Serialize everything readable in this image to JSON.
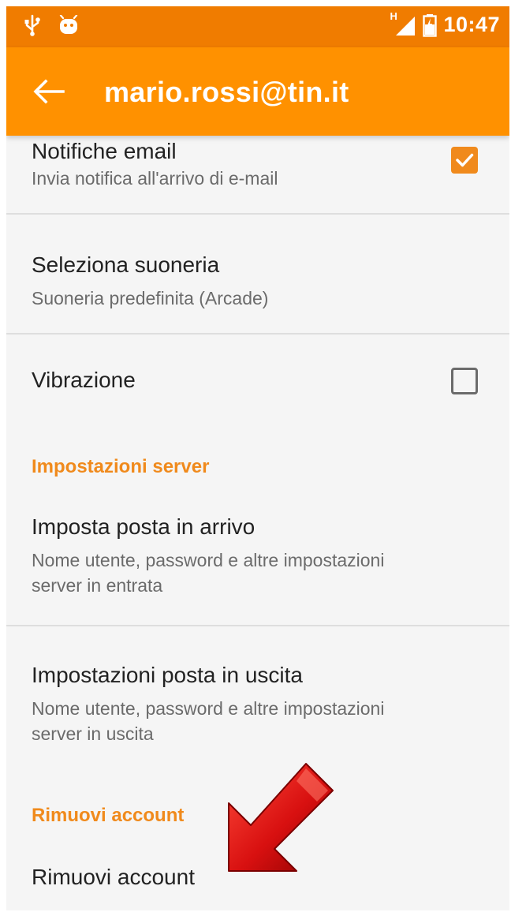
{
  "status_bar": {
    "icons": [
      "usb-icon",
      "android-icon",
      "signal-icon",
      "battery-icon"
    ],
    "network_indicator": "H",
    "time": "10:47"
  },
  "app_bar": {
    "title": "mario.rossi@tin.it",
    "back_icon": "arrow-left-icon"
  },
  "settings": {
    "email_notifications": {
      "title": "Notifiche email",
      "summary": "Invia notifica all'arrivo di e-mail",
      "checked": true
    },
    "ringtone": {
      "title": "Seleziona suoneria",
      "summary": "Suoneria predefinita (Arcade)"
    },
    "vibration": {
      "title": "Vibrazione",
      "checked": false
    },
    "server_category": "Impostazioni server",
    "incoming": {
      "title": "Imposta posta in arrivo",
      "summary_line1": "Nome utente, password e altre impostazioni",
      "summary_line2": "server in entrata"
    },
    "outgoing": {
      "title": "Impostazioni posta in uscita",
      "summary_line1": "Nome utente, password e altre impostazioni",
      "summary_line2": "server in uscita"
    },
    "remove_category": "Rimuovi account",
    "remove_account": {
      "title": "Rimuovi account"
    }
  },
  "colors": {
    "status_bar": "#f07c00",
    "app_bar": "#ff9100",
    "accent": "#f08a1c",
    "background": "#f5f5f5",
    "annotation_arrow": "#d01010"
  }
}
